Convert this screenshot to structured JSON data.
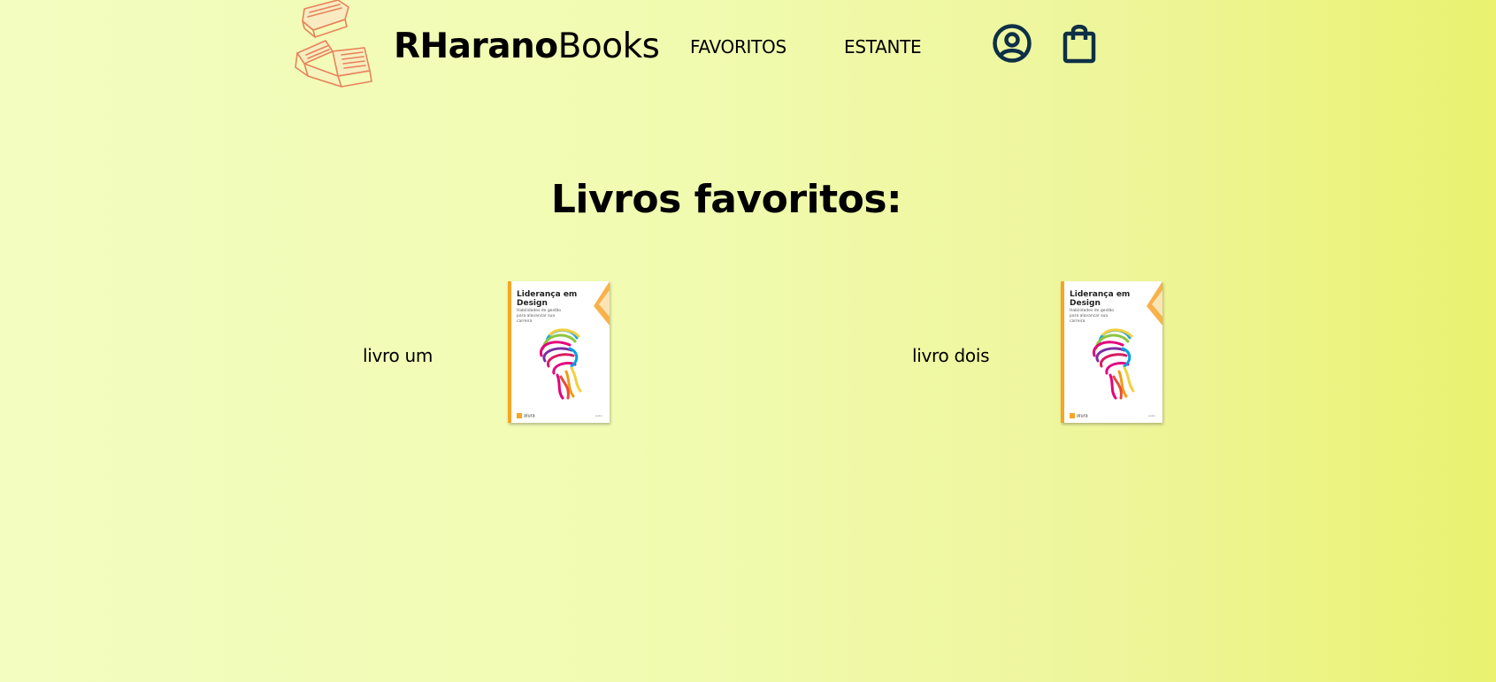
{
  "header": {
    "brand_bold": "RHarano",
    "brand_light": "Books",
    "nav": {
      "favoritos": "FAVORITOS",
      "estante": "ESTANTE"
    },
    "icons": {
      "logo": "books-illustration-icon",
      "user": "user-circle-icon",
      "bag": "shopping-bag-icon"
    }
  },
  "main": {
    "title": "Livros favoritos:",
    "books": [
      {
        "label": "livro um",
        "cover": {
          "title": "Liderança em Design",
          "subtitle": "Habilidades de gestão para alavancar sua carreira",
          "publisher": "alura",
          "author": "autor"
        }
      },
      {
        "label": "livro dois",
        "cover": {
          "title": "Liderança em Design",
          "subtitle": "Habilidades de gestão para alavancar sua carreira",
          "publisher": "alura",
          "author": "autor"
        }
      }
    ]
  },
  "colors": {
    "background_start": "#f3fdc0",
    "background_end": "#eaf270",
    "icon_color": "#0e3046",
    "logo_sketch": "#e8825a",
    "cover_accent": "#f5a623"
  }
}
